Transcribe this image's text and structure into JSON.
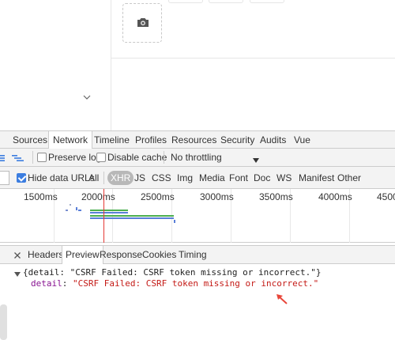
{
  "devtools": {
    "tabs": [
      "Sources",
      "Network",
      "Timeline",
      "Profiles",
      "Resources",
      "Security",
      "Audits",
      "Vue"
    ],
    "active_tab": "Network",
    "toolbar": {
      "preserve_log": "Preserve log",
      "disable_cache": "Disable cache",
      "throttle_value": "No throttling"
    },
    "filters": {
      "hide_data_urls": "Hide data URLs",
      "types": [
        "All",
        "XHR",
        "JS",
        "CSS",
        "Img",
        "Media",
        "Font",
        "Doc",
        "WS",
        "Manifest",
        "Other"
      ],
      "active_type": "XHR"
    },
    "timeline": {
      "ticks": [
        "1500ms",
        "2000ms",
        "2500ms",
        "3000ms",
        "3500ms",
        "4000ms",
        "4500"
      ]
    },
    "detail_tabs": [
      "Headers",
      "Preview",
      "Response",
      "Cookies",
      "Timing"
    ],
    "active_detail_tab": "Preview",
    "preview": {
      "summary_open": "{detail: ",
      "summary_value": "\"CSRF Failed: CSRF token missing or incorrect.\"",
      "summary_close": "}",
      "key": "detail",
      "value": "\"CSRF Failed: CSRF token missing or incorrect.\""
    }
  },
  "colors": {
    "accent": "#3b7de0",
    "string_red": "#c41a16",
    "key_purple": "#881391",
    "annotation_arrow": "#e8463a"
  }
}
